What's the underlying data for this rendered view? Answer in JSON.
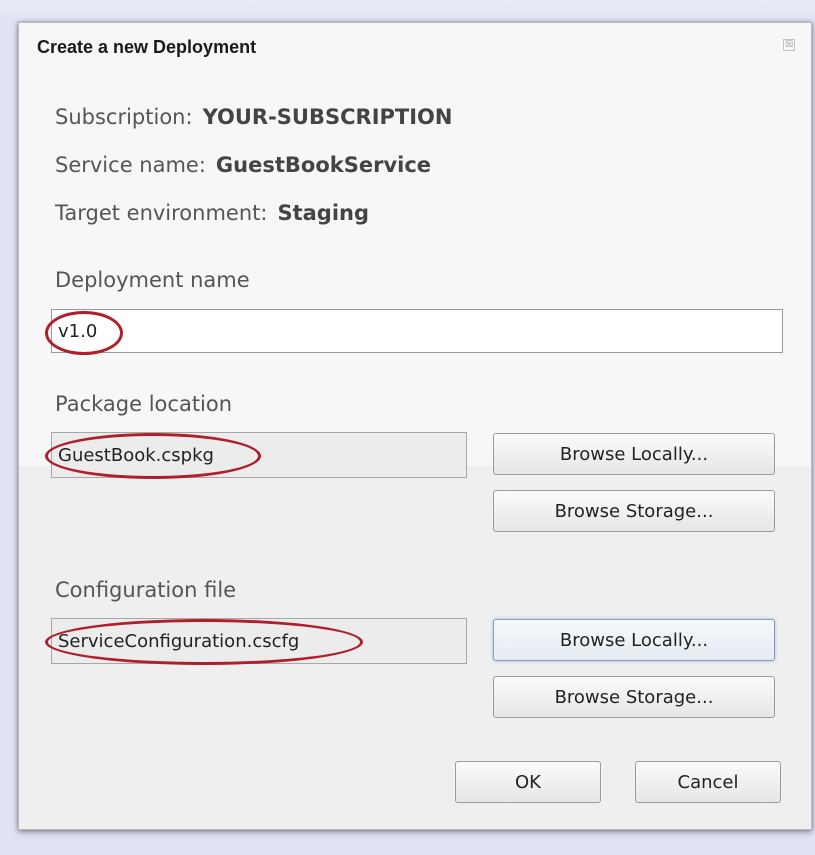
{
  "dialog": {
    "title": "Create a new Deployment",
    "close_glyph": "☒"
  },
  "info": {
    "subscription_label": "Subscription:",
    "subscription_value": "YOUR-SUBSCRIPTION",
    "service_label": "Service name:",
    "service_value": "GuestBookService",
    "environment_label": "Target environment:",
    "environment_value": "Staging"
  },
  "deployment": {
    "label": "Deployment name",
    "value": "v1.0"
  },
  "package": {
    "label": "Package location",
    "value": "GuestBook.cspkg",
    "browse_local_label": "Browse Locally...",
    "browse_storage_label": "Browse Storage..."
  },
  "configuration": {
    "label": "Configuration file",
    "value": "ServiceConfiguration.cscfg",
    "browse_local_label": "Browse Locally...",
    "browse_storage_label": "Browse Storage..."
  },
  "actions": {
    "ok_label": "OK",
    "cancel_label": "Cancel"
  },
  "annotation_color": "#b01e2a"
}
